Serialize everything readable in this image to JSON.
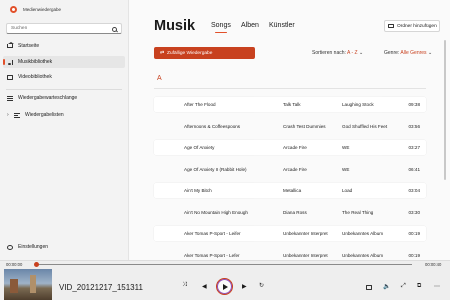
{
  "app": {
    "title": "Medienwiedergabe"
  },
  "sidebar": {
    "search_placeholder": "Suchen",
    "items": [
      {
        "label": "Startseite"
      },
      {
        "label": "Musikbibliothek"
      },
      {
        "label": "Videobibliothek"
      },
      {
        "label": "Wiedergabewarteschlange"
      },
      {
        "label": "Wiedergabelisten"
      }
    ],
    "settings_label": "Einstellungen"
  },
  "main": {
    "title": "Musik",
    "tabs": [
      "Songs",
      "Alben",
      "Künstler"
    ],
    "add_folder_label": "Ordner hinzufügen",
    "shuffle_label": "Zufällige Wiedergabe",
    "sort_label": "Sortieren nach:",
    "sort_value": "A - Z",
    "genre_label": "Genre:",
    "genre_value": "Alle Genres",
    "section_letter": "A",
    "songs": [
      {
        "title": "After The Flood",
        "artist": "Talk Talk",
        "album": "Laughing Stock",
        "duration": "09:38"
      },
      {
        "title": "Afternoons & Coffeespoons",
        "artist": "Crash Test Dummies",
        "album": "God Shuffled His Feet",
        "duration": "03:56"
      },
      {
        "title": "Age Of Anxiety",
        "artist": "Arcade Fire",
        "album": "WE",
        "duration": "03:27"
      },
      {
        "title": "Age Of Anxiety II (Rabbit Hole)",
        "artist": "Arcade Fire",
        "album": "WE",
        "duration": "06:41"
      },
      {
        "title": "Ain't My Bitch",
        "artist": "Metallica",
        "album": "Load",
        "duration": "03:04"
      },
      {
        "title": "Ain't No Mountain High Enough",
        "artist": "Diana Ross",
        "album": "The Real Thing",
        "duration": "03:30"
      },
      {
        "title": "Aker Tomas P-Sport - Leifer",
        "artist": "Unbekannter Interpret",
        "album": "Unbekanntes Album",
        "duration": "00:19"
      },
      {
        "title": "Aker Tomas P-Sport - Lefer",
        "artist": "Unbekannter Interpret",
        "album": "Unbekanntes Album",
        "duration": "00:19"
      }
    ]
  },
  "player": {
    "time_current": "00:00:00",
    "time_total": "00:00:40",
    "progress": 0.0,
    "media_name": "VID_20121217_151311"
  },
  "colors": {
    "accent": "#c8411f",
    "background": "#f3f3f3"
  }
}
